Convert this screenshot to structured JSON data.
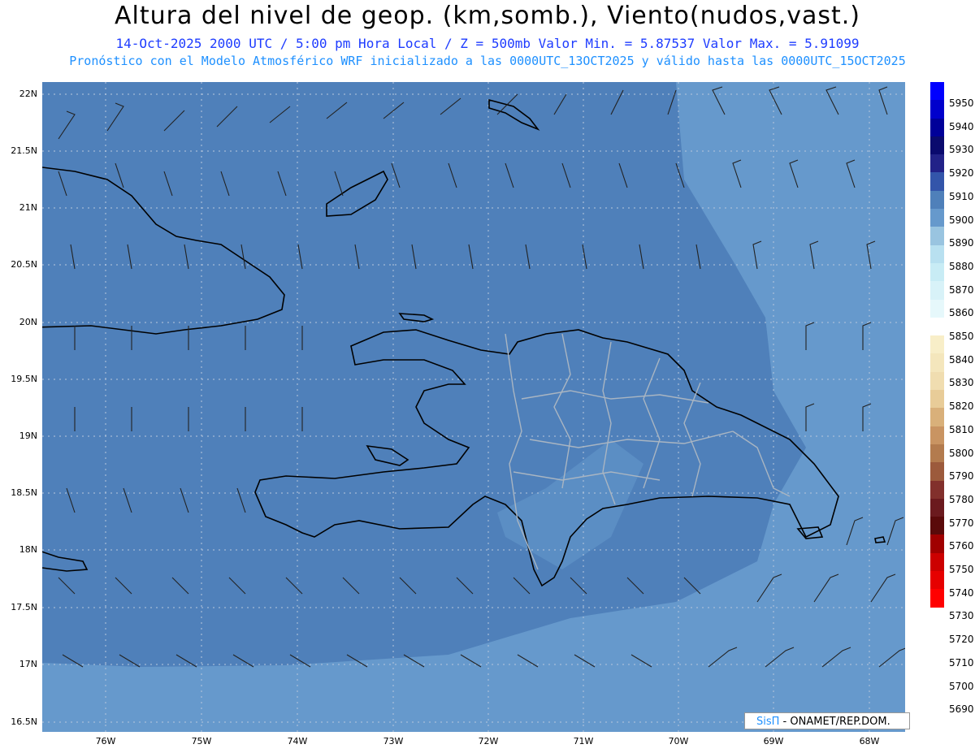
{
  "header": {
    "title": "Altura del nivel de geop. (km,somb.), Viento(nudos,vast.)",
    "subtitle_1": "14-Oct-2025  2000 UTC / 5:00 pm Hora Local / Z = 500mb     Valor Min. = 5.87537  Valor Max. = 5.91099",
    "subtitle_2": "Pronóstico con el Modelo Atmosférico WRF inicializado a las 0000UTC_13OCT2025 y válido hasta las  0000UTC_15OCT2025"
  },
  "axes": {
    "y_labels": [
      "22N",
      "21.5N",
      "21N",
      "20.5N",
      "20N",
      "19.5N",
      "19N",
      "18.5N",
      "18N",
      "17.5N",
      "17N",
      "16.5N"
    ],
    "x_labels": [
      "76W",
      "75W",
      "74W",
      "73W",
      "72W",
      "71W",
      "70W",
      "69W",
      "68W"
    ]
  },
  "colorbar": {
    "labels": [
      "5950",
      "5940",
      "5930",
      "5920",
      "5910",
      "5900",
      "5890",
      "5880",
      "5870",
      "5860",
      "5850",
      "5840",
      "5830",
      "5820",
      "5810",
      "5800",
      "5790",
      "5780",
      "5770",
      "5760",
      "5750",
      "5740",
      "5730",
      "5720",
      "5710",
      "5700",
      "5690"
    ],
    "colors": [
      "#0000ff",
      "#0000cc",
      "#000099",
      "#0a0a6e",
      "#222288",
      "#3355aa",
      "#4f80ba",
      "#6699cc",
      "#99c4e0",
      "#b8e0f0",
      "#c8ecf5",
      "#d8f2f8",
      "#e6f8fb",
      "#ffffff",
      "#f8eec8",
      "#f4e6bc",
      "#f0ddb0",
      "#e8cc98",
      "#d9b07a",
      "#c99462",
      "#b37b4e",
      "#9c5a3c",
      "#82302c",
      "#6b1a1e",
      "#5a0a0a",
      "#a00000",
      "#cc0000",
      "#e60000",
      "#ff0000"
    ],
    "accent": "#4f80ba"
  },
  "credit": {
    "brand": "SisΠ",
    "text": " - ONAMET/REP.DOM."
  }
}
